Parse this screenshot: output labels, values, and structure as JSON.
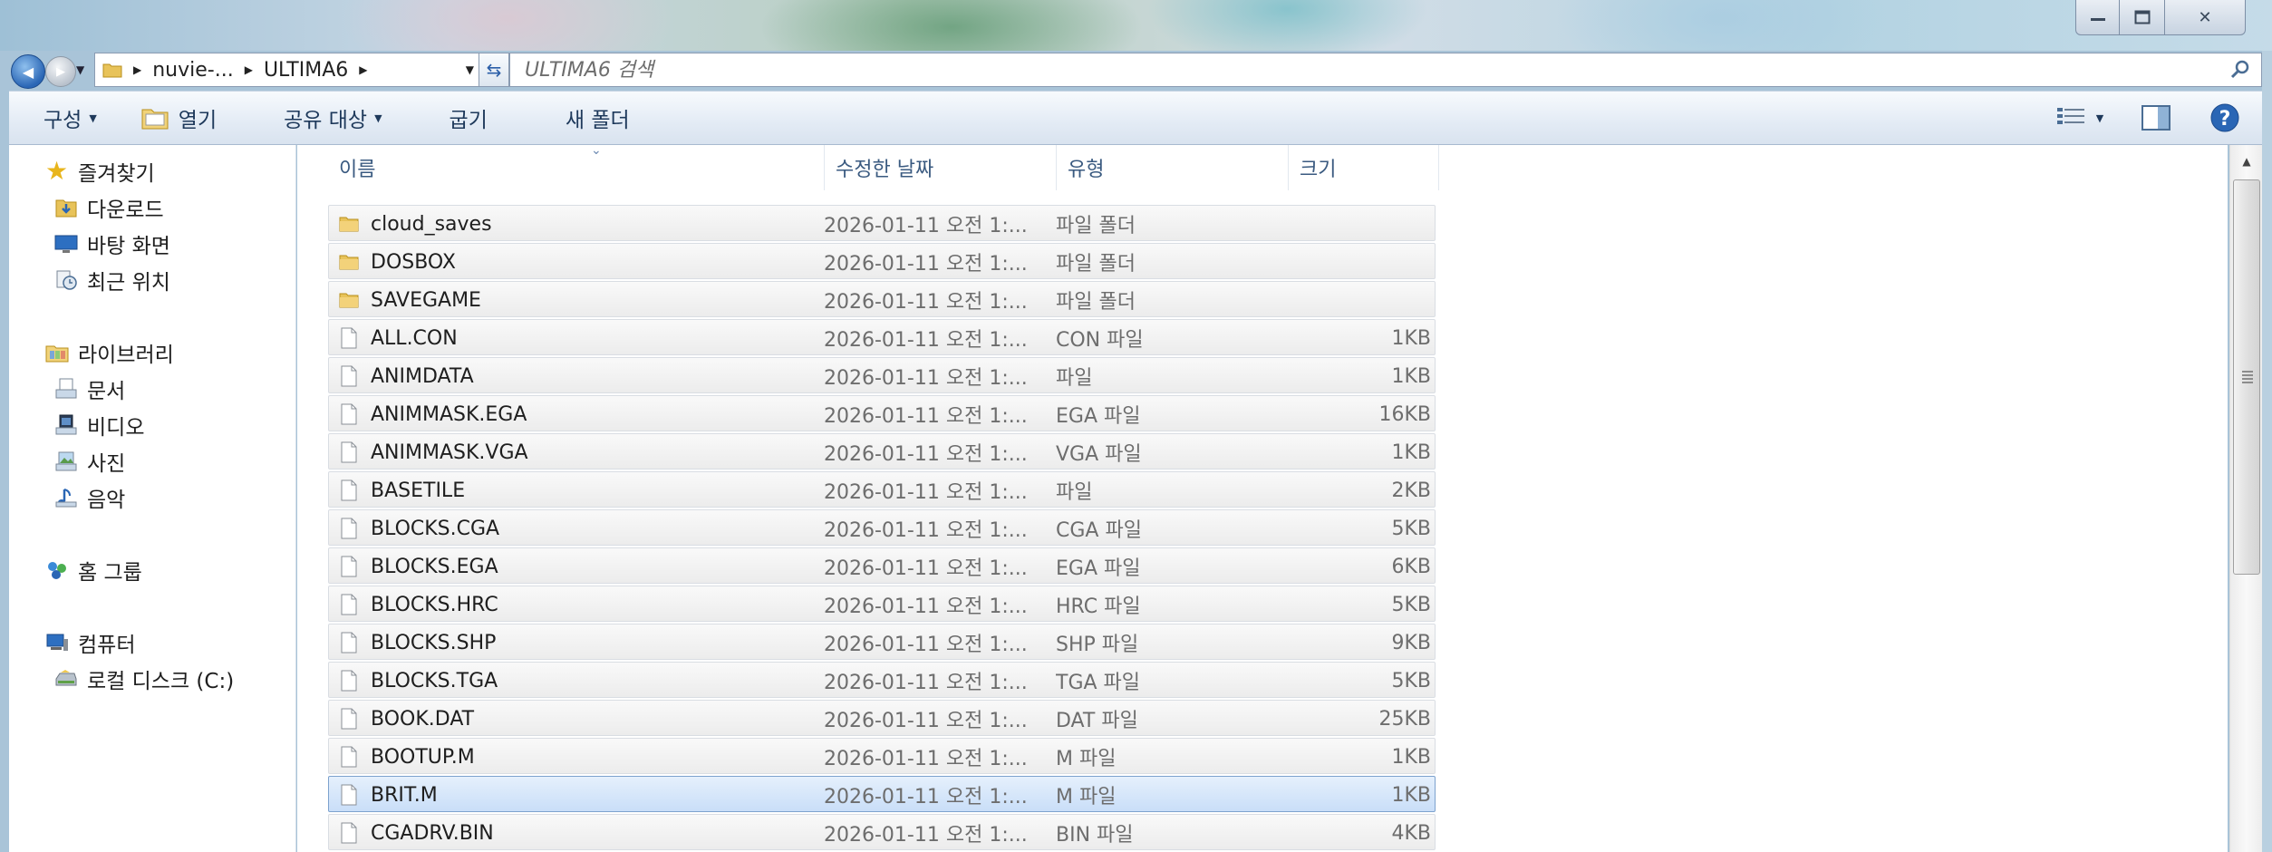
{
  "window": {
    "min_icon": "minimize-icon",
    "max_icon": "maximize-icon",
    "close_icon": "close-icon",
    "close_glyph": "✕"
  },
  "navigation": {
    "back_glyph": "◀",
    "forward_glyph": "▶",
    "breadcrumb": [
      "nuvie-...",
      "ULTIMA6"
    ],
    "search_placeholder": "ULTIMA6 검색"
  },
  "commandbar": {
    "organize": "구성",
    "open": "열기",
    "share": "공유 대상",
    "burn": "굽기",
    "new_folder": "새 폴더"
  },
  "sidebar": {
    "favorites": {
      "label": "즐겨찾기",
      "items": [
        {
          "label": "다운로드",
          "icon": "downloads-folder-icon"
        },
        {
          "label": "바탕 화면",
          "icon": "desktop-icon"
        },
        {
          "label": "최근 위치",
          "icon": "recent-places-icon"
        }
      ]
    },
    "libraries": {
      "label": "라이브러리",
      "items": [
        {
          "label": "문서",
          "icon": "documents-icon"
        },
        {
          "label": "비디오",
          "icon": "videos-icon"
        },
        {
          "label": "사진",
          "icon": "pictures-icon"
        },
        {
          "label": "음악",
          "icon": "music-icon"
        }
      ]
    },
    "homegroup": {
      "label": "홈 그룹"
    },
    "computer": {
      "label": "컴퓨터",
      "items": [
        {
          "label": "로컬 디스크 (C:)",
          "icon": "local-disk-icon"
        }
      ]
    }
  },
  "columns": {
    "name": "이름",
    "date": "수정한 날짜",
    "type": "유형",
    "size": "크기"
  },
  "files": [
    {
      "name": "cloud_saves",
      "date": "2026-01-11 오전 1:...",
      "type": "파일 폴더",
      "size": "",
      "kind": "folder"
    },
    {
      "name": "DOSBOX",
      "date": "2026-01-11 오전 1:...",
      "type": "파일 폴더",
      "size": "",
      "kind": "folder"
    },
    {
      "name": "SAVEGAME",
      "date": "2026-01-11 오전 1:...",
      "type": "파일 폴더",
      "size": "",
      "kind": "folder"
    },
    {
      "name": "ALL.CON",
      "date": "2026-01-11 오전 1:...",
      "type": "CON 파일",
      "size": "1KB",
      "kind": "file"
    },
    {
      "name": "ANIMDATA",
      "date": "2026-01-11 오전 1:...",
      "type": "파일",
      "size": "1KB",
      "kind": "file"
    },
    {
      "name": "ANIMMASK.EGA",
      "date": "2026-01-11 오전 1:...",
      "type": "EGA 파일",
      "size": "16KB",
      "kind": "file"
    },
    {
      "name": "ANIMMASK.VGA",
      "date": "2026-01-11 오전 1:...",
      "type": "VGA 파일",
      "size": "1KB",
      "kind": "file"
    },
    {
      "name": "BASETILE",
      "date": "2026-01-11 오전 1:...",
      "type": "파일",
      "size": "2KB",
      "kind": "file"
    },
    {
      "name": "BLOCKS.CGA",
      "date": "2026-01-11 오전 1:...",
      "type": "CGA 파일",
      "size": "5KB",
      "kind": "file"
    },
    {
      "name": "BLOCKS.EGA",
      "date": "2026-01-11 오전 1:...",
      "type": "EGA 파일",
      "size": "6KB",
      "kind": "file"
    },
    {
      "name": "BLOCKS.HRC",
      "date": "2026-01-11 오전 1:...",
      "type": "HRC 파일",
      "size": "5KB",
      "kind": "file"
    },
    {
      "name": "BLOCKS.SHP",
      "date": "2026-01-11 오전 1:...",
      "type": "SHP 파일",
      "size": "9KB",
      "kind": "file"
    },
    {
      "name": "BLOCKS.TGA",
      "date": "2026-01-11 오전 1:...",
      "type": "TGA 파일",
      "size": "5KB",
      "kind": "file"
    },
    {
      "name": "BOOK.DAT",
      "date": "2026-01-11 오전 1:...",
      "type": "DAT 파일",
      "size": "25KB",
      "kind": "file"
    },
    {
      "name": "BOOTUP.M",
      "date": "2026-01-11 오전 1:...",
      "type": "M 파일",
      "size": "1KB",
      "kind": "file"
    },
    {
      "name": "BRIT.M",
      "date": "2026-01-11 오전 1:...",
      "type": "M 파일",
      "size": "1KB",
      "kind": "file",
      "selected": true
    },
    {
      "name": "CGADRV.BIN",
      "date": "2026-01-11 오전 1:...",
      "type": "BIN 파일",
      "size": "4KB",
      "kind": "file"
    }
  ],
  "colors": {
    "selection": "#cce0f8",
    "header_text": "#3a5a80",
    "accent": "#2a66b5"
  }
}
